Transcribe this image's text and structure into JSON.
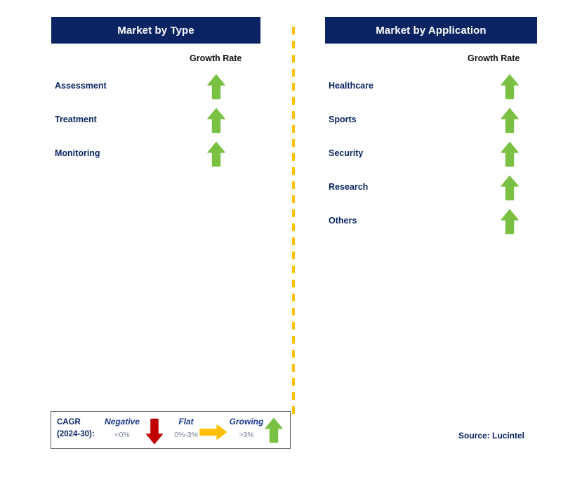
{
  "colors": {
    "header_bg": "#0a2463",
    "label_navy": "#0a2463",
    "arrow_green": "#7ac143",
    "arrow_red": "#c00000",
    "arrow_amber": "#ffc000",
    "divider_amber": "#ffc107",
    "legend_border": "#5a5a5a",
    "legend_range_gray": "#7a8599"
  },
  "panels": [
    {
      "title": "Market by Type",
      "column_header": "Growth Rate",
      "rows": [
        {
          "label": "Assessment",
          "growth": "growing",
          "icon": "arrow-up-icon"
        },
        {
          "label": "Treatment",
          "growth": "growing",
          "icon": "arrow-up-icon"
        },
        {
          "label": "Monitoring",
          "growth": "growing",
          "icon": "arrow-up-icon"
        }
      ]
    },
    {
      "title": "Market by Application",
      "column_header": "Growth Rate",
      "rows": [
        {
          "label": "Healthcare",
          "growth": "growing",
          "icon": "arrow-up-icon"
        },
        {
          "label": "Sports",
          "growth": "growing",
          "icon": "arrow-up-icon"
        },
        {
          "label": "Security",
          "growth": "growing",
          "icon": "arrow-up-icon"
        },
        {
          "label": "Research",
          "growth": "growing",
          "icon": "arrow-up-icon"
        },
        {
          "label": "Others",
          "growth": "growing",
          "icon": "arrow-up-icon"
        }
      ]
    }
  ],
  "legend": {
    "cagr_line1": "CAGR",
    "cagr_line2": "(2024-30):",
    "items": [
      {
        "title": "Negative",
        "range": "<0%",
        "icon": "arrow-down-icon"
      },
      {
        "title": "Flat",
        "range": "0%-3%",
        "icon": "arrow-right-icon"
      },
      {
        "title": "Growing",
        "range": ">3%",
        "icon": "arrow-up-icon"
      }
    ]
  },
  "source": "Source: Lucintel"
}
